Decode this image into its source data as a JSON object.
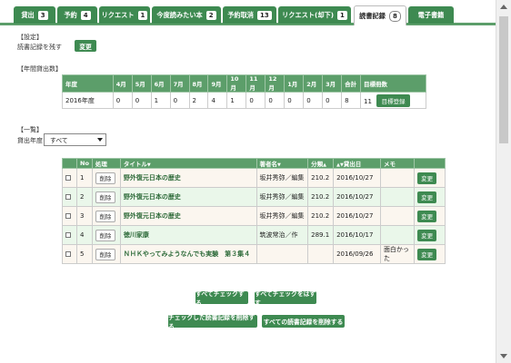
{
  "tabs": [
    {
      "label": "貸出",
      "count": "3"
    },
    {
      "label": "予約",
      "count": "4"
    },
    {
      "label": "リクエスト",
      "count": "1"
    },
    {
      "label": "今度読みたい本",
      "count": "2"
    },
    {
      "label": "予約取消",
      "count": "13"
    },
    {
      "label": "リクエスト(却下)",
      "count": "1"
    },
    {
      "label": "読書記録",
      "count": "8"
    },
    {
      "label": "電子書籍",
      "count": ""
    }
  ],
  "settings": {
    "section_label": "【設定】",
    "record_label": "読書記録を残す",
    "change_button": "変更"
  },
  "annual": {
    "section_label": "【年間貸出数】",
    "headers": [
      "年度",
      "4月",
      "5月",
      "6月",
      "7月",
      "8月",
      "9月",
      "10月",
      "11月",
      "12月",
      "1月",
      "2月",
      "3月",
      "合計",
      "目標冊数"
    ],
    "row": {
      "year": "2016年度",
      "months": [
        "0",
        "0",
        "1",
        "0",
        "2",
        "4",
        "1",
        "0",
        "0",
        "0",
        "0",
        "0"
      ],
      "total": "8",
      "goal": "11",
      "goal_button": "目標登録"
    }
  },
  "list": {
    "section_label": "【一覧】",
    "filter_label": "貸出年度",
    "filter_value": "すべて",
    "headers": {
      "no": "No",
      "action": "処理",
      "title": "タイトル",
      "author": "著者名",
      "class": "分類",
      "date": "貸出日",
      "memo": "メモ"
    },
    "sort_title": "▼",
    "sort_author": "▼",
    "sort_class": "▲",
    "sort_date": "▲▼",
    "delete_label": "削除",
    "edit_label": "変更",
    "rows": [
      {
        "no": "1",
        "title": "野外復元日本の歴史",
        "author": "坂井秀弥／編集",
        "class": "210.2",
        "date": "2016/10/27",
        "memo": ""
      },
      {
        "no": "2",
        "title": "野外復元日本の歴史",
        "author": "坂井秀弥／編集",
        "class": "210.2",
        "date": "2016/10/27",
        "memo": ""
      },
      {
        "no": "3",
        "title": "野外復元日本の歴史",
        "author": "坂井秀弥／編集",
        "class": "210.2",
        "date": "2016/10/27",
        "memo": ""
      },
      {
        "no": "4",
        "title": "徳川家康",
        "author": "筑波常治／作",
        "class": "289.1",
        "date": "2016/10/17",
        "memo": ""
      },
      {
        "no": "5",
        "title": "ＮＨＫやってみようなんでも実験　第３集４",
        "author": "",
        "class": "",
        "date": "2016/09/26",
        "memo": "面白かった"
      }
    ]
  },
  "actions": {
    "check_all": "すべてチェックする",
    "uncheck_all": "すべてチェックをはずす",
    "delete_checked": "チェックした読書記録を削除する",
    "delete_all": "すべての読書記録を削除する"
  }
}
